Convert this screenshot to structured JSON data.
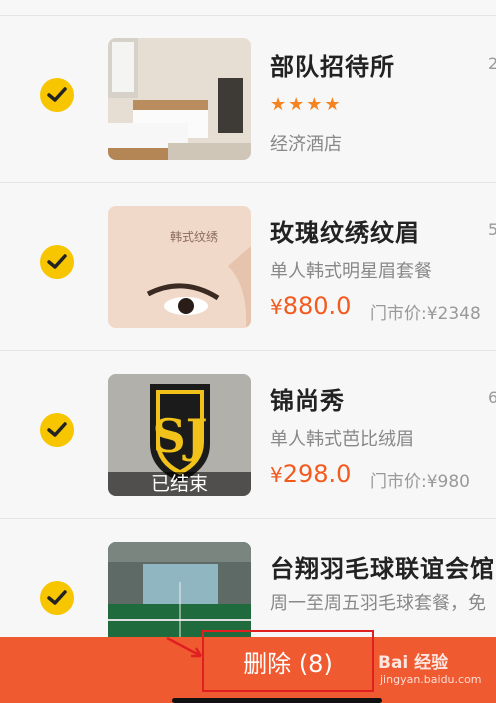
{
  "items": [
    {
      "title": "部队招待所",
      "distance": "2",
      "rating_stars": "★★★★",
      "subtitle": "经济酒店",
      "thumb_icon": "hotel-room-photo"
    },
    {
      "title": "玫瑰纹绣纹眉",
      "distance": "5",
      "subtitle": "单人韩式明星眉套餐",
      "price_currency": "¥",
      "price": "880.0",
      "original_price": "门市价:¥2348",
      "thumb_text": "韩式纹绣",
      "thumb_icon": "eyebrow-photo"
    },
    {
      "title": "锦尚秀",
      "distance": "6",
      "subtitle": "单人韩式芭比绒眉",
      "price_currency": "¥",
      "price": "298.0",
      "original_price": "门市价:¥980",
      "ended_label": "已结束",
      "thumb_icon": "sj-logo"
    },
    {
      "title": "台翔羽毛球联谊会馆",
      "subtitle": "周一至周五羽毛球套餐，免",
      "thumb_icon": "badminton-hall-photo"
    }
  ],
  "bottom": {
    "delete_label": "删除 (8)",
    "watermark": "Bai  经验",
    "watermark_sub": "jingyan.baidu.com"
  },
  "colors": {
    "accent": "#f25a1e",
    "bar": "#f05a30",
    "check": "#f7c600"
  }
}
